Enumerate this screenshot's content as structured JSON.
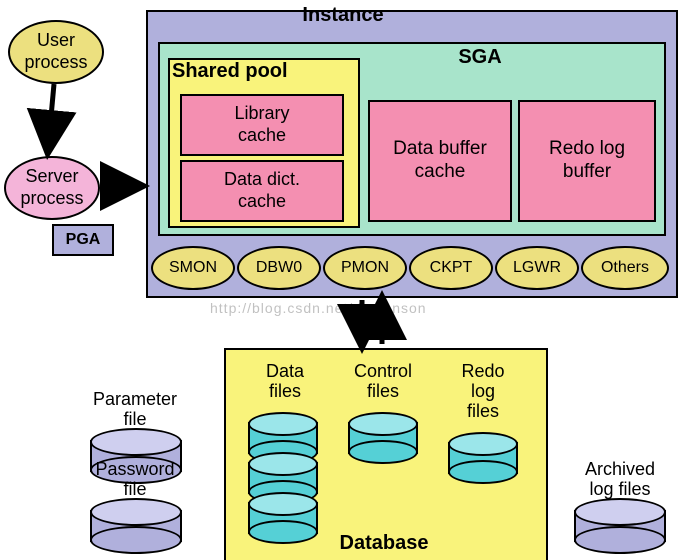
{
  "user_process": "User\nprocess",
  "server_process": "Server\nprocess",
  "pga": "PGA",
  "instance_title": "Instance",
  "sga_title": "SGA",
  "shared_pool_title": "Shared pool",
  "library_cache": "Library\ncache",
  "data_dict_cache": "Data dict.\ncache",
  "data_buffer_cache": "Data buffer\ncache",
  "redo_log_buffer": "Redo log\nbuffer",
  "processes": {
    "smon": "SMON",
    "dbw0": "DBW0",
    "pmon": "PMON",
    "ckpt": "CKPT",
    "lgwr": "LGWR",
    "others": "Others"
  },
  "database_title": "Database",
  "files": {
    "data_files": "Data\nfiles",
    "control_files": "Control\nfiles",
    "redo_log_files": "Redo\nlog\nfiles",
    "parameter_file": "Parameter\nfile",
    "password_file": "Password\nfile",
    "archived_log_files": "Archived\nlog files"
  },
  "watermark": "http://blog.csdn.net/demonson"
}
